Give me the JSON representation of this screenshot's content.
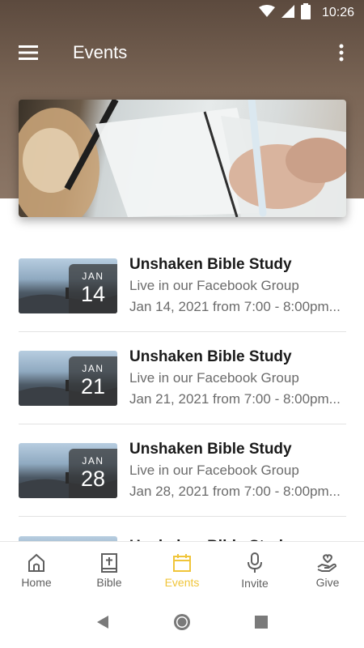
{
  "status_bar": {
    "time": "10:26"
  },
  "app_bar": {
    "title": "Events"
  },
  "events": [
    {
      "month": "JAN",
      "day": "14",
      "name": "Unshaken Bible Study",
      "location": "Live in our Facebook Group",
      "when": "Jan 14, 2021 from 7:00 - 8:00pm..."
    },
    {
      "month": "JAN",
      "day": "21",
      "name": "Unshaken Bible Study",
      "location": "Live in our Facebook Group",
      "when": "Jan 21, 2021 from 7:00 - 8:00pm..."
    },
    {
      "month": "JAN",
      "day": "28",
      "name": "Unshaken Bible Study",
      "location": "Live in our Facebook Group",
      "when": "Jan 28, 2021 from 7:00 - 8:00pm..."
    },
    {
      "month": "",
      "day": "",
      "name": "Unshaken Bible Study",
      "location": "",
      "when": ""
    }
  ],
  "bottom_nav": {
    "items": [
      {
        "label": "Home",
        "icon": "home-icon"
      },
      {
        "label": "Bible",
        "icon": "bible-icon"
      },
      {
        "label": "Events",
        "icon": "calendar-icon",
        "active": true
      },
      {
        "label": "Invite",
        "icon": "microphone-icon"
      },
      {
        "label": "Give",
        "icon": "give-hand-heart-icon"
      }
    ]
  },
  "colors": {
    "accent": "#f0c53a",
    "header": "#6b5646",
    "inactive": "#5f5f5f"
  }
}
